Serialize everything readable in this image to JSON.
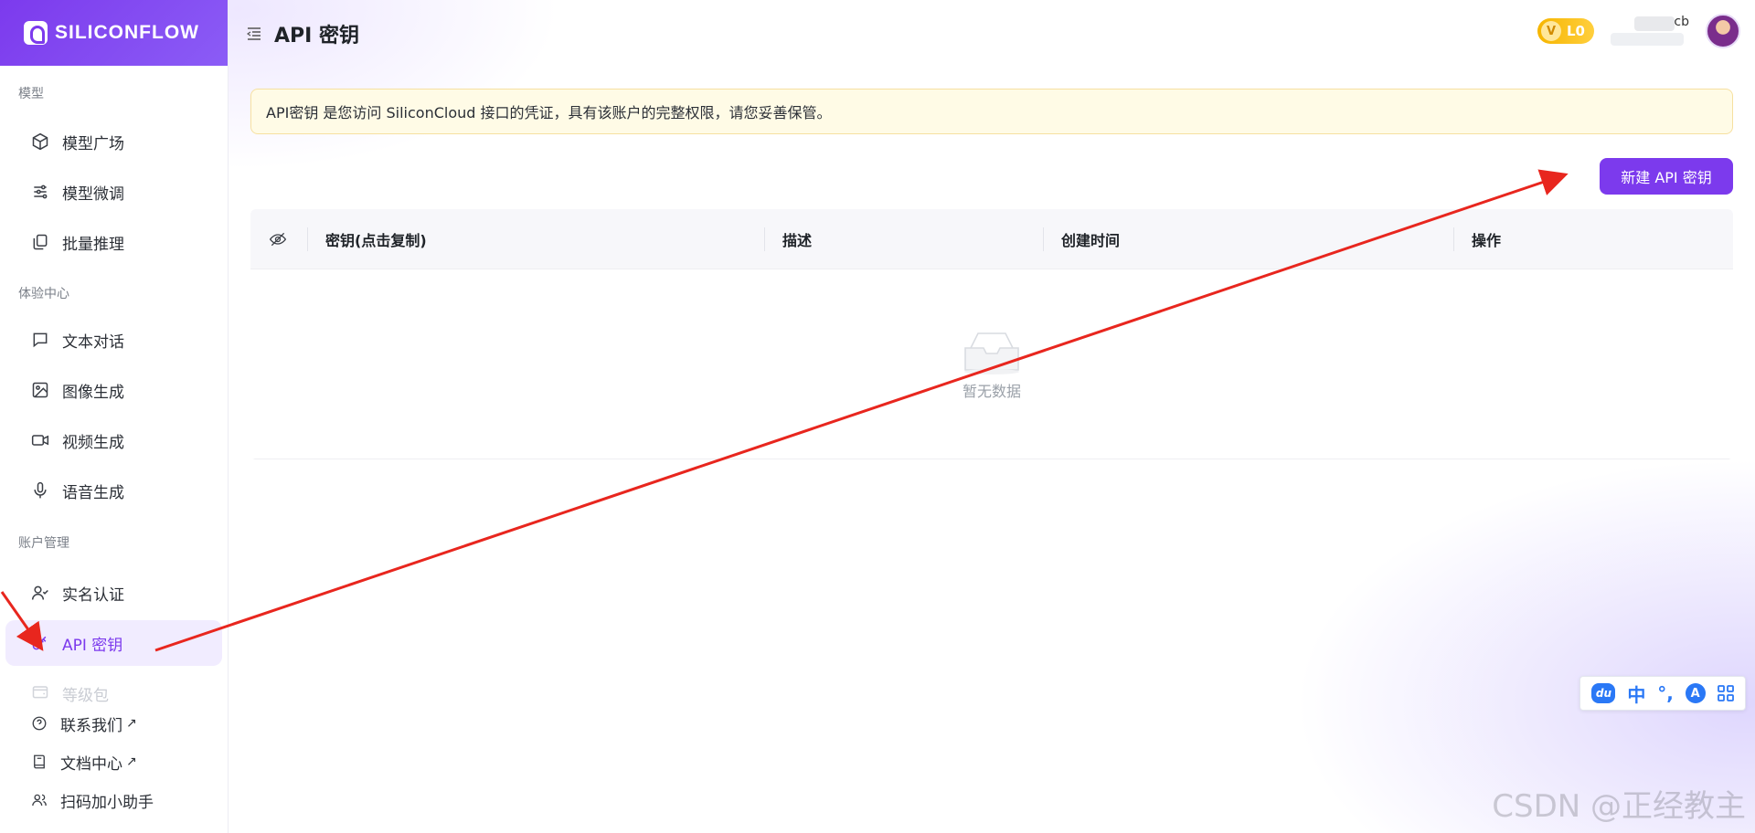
{
  "brand": {
    "name": "SILICONFLOW"
  },
  "header": {
    "title": "API 密钥",
    "level": "L0",
    "level_prefix": "V",
    "username_tail": "cb"
  },
  "sidebar": {
    "groups": [
      {
        "title": "模型",
        "items": [
          "模型广场",
          "模型微调",
          "批量推理"
        ]
      },
      {
        "title": "体验中心",
        "items": [
          "文本对话",
          "图像生成",
          "视频生成",
          "语音生成"
        ]
      },
      {
        "title": "账户管理",
        "items": [
          "实名认证",
          "API 密钥",
          "等级包"
        ]
      }
    ],
    "footer_items": [
      "联系我们",
      "文档中心",
      "扫码加小助手"
    ],
    "external_mark": "↗"
  },
  "notice": {
    "text": "API密钥 是您访问 SiliconCloud 接口的凭证，具有该账户的完整权限，请您妥善保管。"
  },
  "actions": {
    "new_key": "新建 API 密钥"
  },
  "table": {
    "columns": [
      "密钥(点击复制)",
      "描述",
      "创建时间",
      "操作"
    ],
    "rows": [],
    "empty_text": "暂无数据"
  },
  "ime": {
    "du": "du",
    "zh": "中",
    "punct": "°,",
    "a": "A"
  },
  "watermark": "CSDN @正经教主",
  "colors": {
    "accent": "#7c3aed",
    "notice_bg": "#fffbe6",
    "arrow": "#e8261e"
  }
}
